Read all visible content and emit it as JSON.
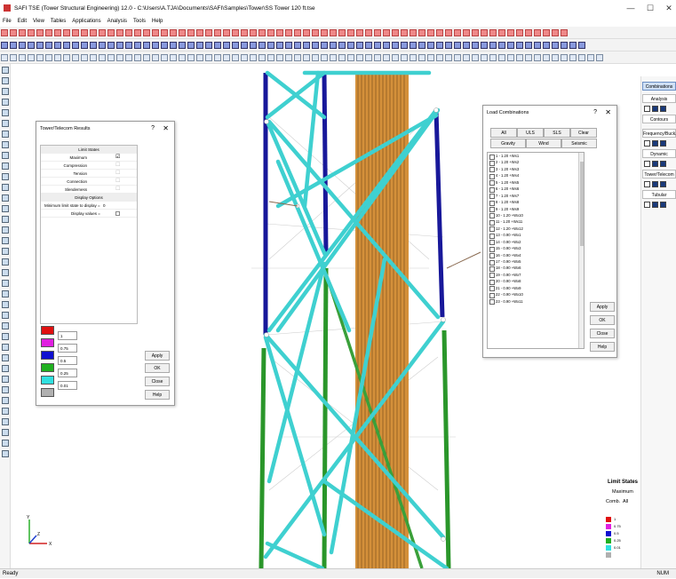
{
  "window": {
    "title": "SAFI TSE (Tower Structural Engineering) 12.0 - C:\\Users\\A.TJA\\Documents\\SAFI\\Samples\\Tower\\SS Tower 120 ft.tse",
    "minimize": "—",
    "maximize": "☐",
    "close": "✕"
  },
  "menu": [
    "File",
    "Edit",
    "View",
    "Tables",
    "Applications",
    "Analysis",
    "Tools",
    "Help"
  ],
  "tower_dialog": {
    "title": "Tower/Telecom Results",
    "help": "?",
    "close": "✕",
    "limit_states_header": "Limit States",
    "rows": [
      {
        "label": "Maximum",
        "checked": "☑"
      },
      {
        "label": "Compression",
        "checked": "☐"
      },
      {
        "label": "Tension",
        "checked": "☐"
      },
      {
        "label": "Connection",
        "checked": "☐"
      },
      {
        "label": "Slenderness",
        "checked": "☐"
      }
    ],
    "display_header": "Display Options",
    "min_limit_label": "Minimum limit state to display =",
    "min_limit_value": "0",
    "display_values_label": "Display values =",
    "legend": [
      {
        "color": "#e01010",
        "value": "1"
      },
      {
        "color": "#e020e0",
        "value": "0.75"
      },
      {
        "color": "#1010d0",
        "value": "0.5"
      },
      {
        "color": "#20b020",
        "value": "0.25"
      },
      {
        "color": "#30e0e0",
        "value": "0.01"
      },
      {
        "color": "#b0b0b0",
        "value": ""
      }
    ],
    "buttons": [
      "Apply",
      "OK",
      "Close",
      "Help"
    ]
  },
  "load_dialog": {
    "title": "Load Combinations",
    "help": "?",
    "close": "✕",
    "buttons_row1": [
      "All",
      "ULS",
      "SLS",
      "Clear"
    ],
    "buttons_row2": [
      "Gravity",
      "Wind",
      "Seismic"
    ],
    "items": [
      "1 - 1.20 +Wx1",
      "2 - 1.20 +Wx2",
      "3 - 1.20 +Wx3",
      "4 - 1.20 +Wx4",
      "5 - 1.20 +Wx5",
      "6 - 1.20 +Wx6",
      "7 - 1.20 +Wx7",
      "8 - 1.20 +Wx8",
      "9 - 1.20 +Wx9",
      "10 - 1.20 +Wx10",
      "11 - 1.20 +Wx11",
      "12 - 1.20 +Wx12",
      "13 - 0.90 +Wx1",
      "14 - 0.90 +Wx2",
      "15 - 0.90 +Wx3",
      "16 - 0.90 +Wx4",
      "17 - 0.90 +Wx5",
      "18 - 0.90 +Wx6",
      "19 - 0.90 +Wx7",
      "20 - 0.90 +Wx8",
      "21 - 0.90 +Wx9",
      "22 - 0.90 +Wx10",
      "23 - 0.90 +Wx11"
    ],
    "side_buttons": [
      "Apply",
      "OK",
      "Close",
      "Help"
    ]
  },
  "right_panel": {
    "tabs": [
      "Combinations",
      "Analysis",
      "Contours",
      "Frequency/Buck.",
      "Dynamic",
      "Tower/Telecom",
      "Tubular"
    ]
  },
  "viewport_legend": {
    "title": "Limit States",
    "line2": "Maximum",
    "line3": "Comb.  All",
    "entries": [
      {
        "color": "#e01010",
        "value": "1"
      },
      {
        "color": "#e020e0",
        "value": "0.75"
      },
      {
        "color": "#1010d0",
        "value": "0.5"
      },
      {
        "color": "#20b020",
        "value": "0.25"
      },
      {
        "color": "#30e0e0",
        "value": "0.01"
      },
      {
        "color": "#b0b0b0",
        "value": ""
      }
    ]
  },
  "axis": {
    "x": "X",
    "y": "Y",
    "z": "Z"
  },
  "status": {
    "left": "Ready",
    "right": "NUM"
  }
}
